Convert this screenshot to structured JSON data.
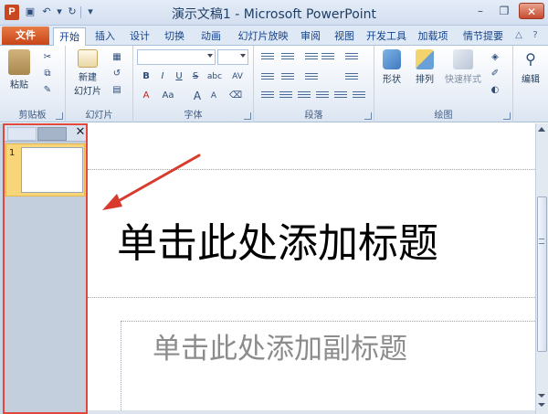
{
  "window": {
    "app_logo": "P",
    "title": "演示文稿1 - Microsoft PowerPoint",
    "minimize": "–",
    "maximize": "❐",
    "close": "✕"
  },
  "tabs": [
    {
      "label": "文件"
    },
    {
      "label": "开始"
    },
    {
      "label": "插入"
    },
    {
      "label": "设计"
    },
    {
      "label": "切换"
    },
    {
      "label": "动画"
    },
    {
      "label": "幻灯片放映"
    },
    {
      "label": "审阅"
    },
    {
      "label": "视图"
    },
    {
      "label": "开发工具"
    },
    {
      "label": "加载项"
    },
    {
      "label": "情节提要"
    }
  ],
  "ribbon": {
    "clipboard": {
      "paste": "粘贴",
      "label": "剪贴板"
    },
    "slides": {
      "new_slide_line1": "新建",
      "new_slide_line2": "幻灯片",
      "label": "幻灯片"
    },
    "font": {
      "label": "字体",
      "bold": "B",
      "italic": "I",
      "underline": "U",
      "strike": "S",
      "shadow": "abc",
      "spacing": "AV",
      "color_a": "A",
      "case": "Aa",
      "grow": "A",
      "shrink": "A"
    },
    "paragraph": {
      "label": "段落"
    },
    "drawing": {
      "shapes": "形状",
      "arrange": "排列",
      "quick_styles": "快速样式",
      "label": "绘图"
    },
    "editing": {
      "label": "编辑"
    }
  },
  "thumbnails": {
    "slide_number": "1"
  },
  "slide": {
    "title_placeholder": "单击此处添加标题",
    "subtitle_placeholder": "单击此处添加副标题"
  },
  "colors": {
    "file_tab": "#c84518",
    "highlight_box": "#e0483d",
    "arrow": "#d83a2d"
  }
}
